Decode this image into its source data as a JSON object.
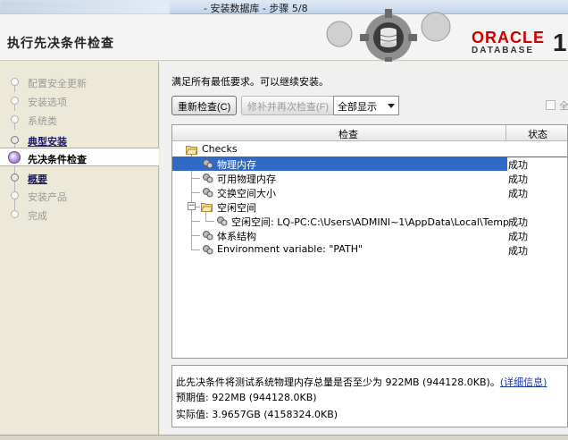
{
  "window": {
    "title": "- 安装数据库 - 步骤 5/8"
  },
  "header": {
    "title": "执行先决条件检查",
    "brand": "ORACLE",
    "brand_sub": "DATABASE",
    "version": "1",
    "brand_color": "#cc0000"
  },
  "sidebar": {
    "items": [
      {
        "label": "配置安全更新",
        "state": "disabled"
      },
      {
        "label": "安装选项",
        "state": "disabled"
      },
      {
        "label": "系统类",
        "state": "disabled"
      },
      {
        "label": "典型安装",
        "state": "link"
      },
      {
        "label": "先决条件检查",
        "state": "active"
      },
      {
        "label": "概要",
        "state": "link"
      },
      {
        "label": "安装产品",
        "state": "disabled"
      },
      {
        "label": "完成",
        "state": "disabled"
      }
    ]
  },
  "main": {
    "message": "满足所有最低要求。可以继续安装。",
    "buttons": {
      "recheck": "重新检查(C)",
      "fix_recheck": "修补并再次检查(F)"
    },
    "filter": {
      "value": "全部显示"
    },
    "ignore_checkbox": {
      "label": "全",
      "checked": false
    },
    "table": {
      "headers": {
        "check": "检查",
        "status": "状态"
      },
      "rows": [
        {
          "name": "Checks",
          "status": "",
          "level": 0,
          "type": "folder",
          "selected": false
        },
        {
          "name": "物理内存",
          "status": "成功",
          "level": 1,
          "type": "gear",
          "selected": true
        },
        {
          "name": "可用物理内存",
          "status": "成功",
          "level": 1,
          "type": "gear",
          "selected": false
        },
        {
          "name": "交换空间大小",
          "status": "成功",
          "level": 1,
          "type": "gear",
          "selected": false
        },
        {
          "name": "空闲空间",
          "status": "",
          "level": 1,
          "type": "folder",
          "selected": false
        },
        {
          "name": "空闲空间: LQ-PC:C:\\Users\\ADMINI~1\\AppData\\Local\\Temp",
          "status": "成功",
          "level": 2,
          "type": "gear",
          "selected": false
        },
        {
          "name": "体系结构",
          "status": "成功",
          "level": 1,
          "type": "gear",
          "selected": false
        },
        {
          "name": "Environment variable: \"PATH\"",
          "status": "成功",
          "level": 1,
          "type": "gear",
          "selected": false
        }
      ]
    },
    "details": {
      "description": "此先决条件将测试系统物理内存总量是否至少为 922MB (944128.0KB)。",
      "more_link": "(详细信息)",
      "expected_label": "预期值",
      "expected_value": ": 922MB (944128.0KB)",
      "actual_label": "实际值",
      "actual_value": ": 3.9657GB (4158324.0KB)"
    }
  },
  "colors": {
    "selection": "#3169c6",
    "link": "#1a3a9e"
  }
}
